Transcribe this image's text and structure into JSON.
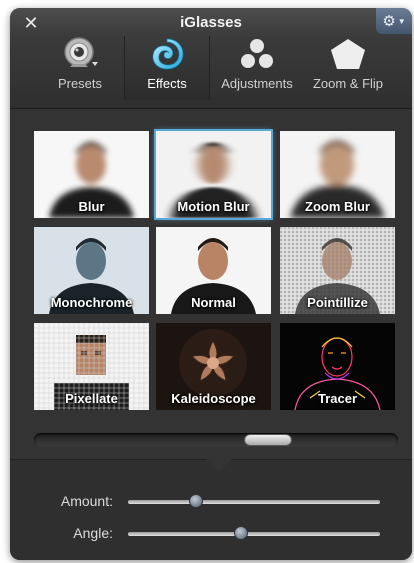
{
  "window": {
    "title": "iGlasses",
    "close_icon": "close-icon",
    "gear_icon": "gear-icon"
  },
  "tabs": [
    {
      "label": "Presets",
      "icon": "webcam-icon",
      "active": false
    },
    {
      "label": "Effects",
      "icon": "swirl-icon",
      "active": true
    },
    {
      "label": "Adjustments",
      "icon": "dots-icon",
      "active": false
    },
    {
      "label": "Zoom & Flip",
      "icon": "pentagon-icon",
      "active": false
    }
  ],
  "effects": [
    {
      "label": "Blur",
      "selected": false
    },
    {
      "label": "Motion Blur",
      "selected": true
    },
    {
      "label": "Zoom Blur",
      "selected": false
    },
    {
      "label": "Monochrome",
      "selected": false
    },
    {
      "label": "Normal",
      "selected": false
    },
    {
      "label": "Pointillize",
      "selected": false
    },
    {
      "label": "Pixellate",
      "selected": false
    },
    {
      "label": "Kaleidoscope",
      "selected": false
    },
    {
      "label": "Tracer",
      "selected": false
    }
  ],
  "controls": {
    "amount": {
      "label": "Amount:",
      "value": 0.27
    },
    "angle": {
      "label": "Angle:",
      "value": 0.45
    }
  },
  "colors": {
    "accent": "#5aa6d6",
    "panel": "#2a2a2a"
  }
}
